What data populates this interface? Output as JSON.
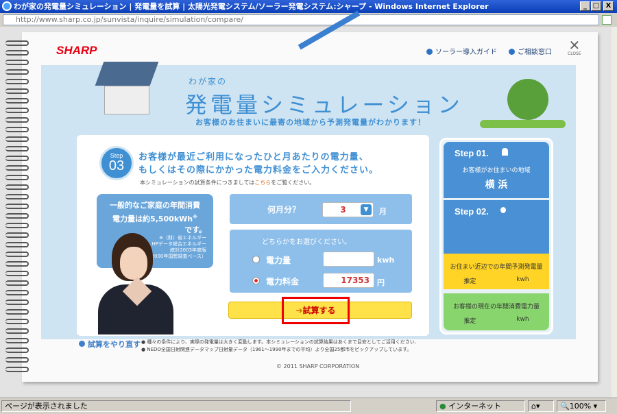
{
  "window": {
    "title": "わが家の発電量シミュレーション | 発電量を試算 | 太陽光発電システム/ソーラー発電システム:シャープ - Windows Internet Explorer",
    "minimize": "_",
    "maximize": "□",
    "close": "X"
  },
  "address": {
    "url": "http://www.sharp.co.jp/sunvista/inquire/simulation/compare/"
  },
  "header": {
    "logo": "SHARP",
    "link_guide": "ソーラー導入ガイド",
    "link_contact": "ご相談窓口",
    "close_label": "CLOSE"
  },
  "hero": {
    "small": "わが家の",
    "title": "発電量シミュレーション",
    "subtitle": "お客様のお住まいに最寄の地域から予測発電量がわかります！"
  },
  "step3": {
    "step_word": "Step",
    "step_num": "03",
    "question_line1": "お客様が最近ご利用になったひと月あたりの電力量、",
    "question_line2": "もしくはその際にかかった電力料金をご入力ください。",
    "note_pre": "本シミュレーションの試算条件につきましては",
    "note_link": "こちら",
    "note_post": "をご覧ください。"
  },
  "info": {
    "line1": "一般的なご家庭の年間消費",
    "line2": "電力量は約5,500kWh",
    "mark": "※",
    "line3": "です。",
    "src1": "※（財）省エネルギー",
    "src2": "HPデータ総合エネルギー",
    "src3": "統計2003年度版",
    "src4": "（2000年国勢調査ベース）"
  },
  "form": {
    "month_label": "何月分？",
    "month_value": "3",
    "month_unit": "月",
    "choose_label": "どちらかをお選びください。",
    "kwh_label": "電力量",
    "kwh_value": "",
    "kwh_unit": "kwh",
    "fee_label": "電力料金",
    "fee_value": "17353",
    "fee_unit": "円",
    "submit": "試算する"
  },
  "sidebar": {
    "step1": "Step 01.",
    "step1_desc": "お客様がお住まいの地域",
    "step1_value": "横 浜",
    "step2": "Step 02.",
    "yellow_title": "お住まい近辺での年間予測発電量",
    "yellow_est": "推定",
    "yellow_unit": "kwh",
    "green_title": "お客様の現在の年間消費電力量",
    "green_est": "推定",
    "green_unit": "kwh"
  },
  "footer": {
    "redo": "試算をやり直す",
    "note1": "● 種々の条件により、実際の発電量は大きく変動します。本シミュレーションの試算結果はあくまで目安としてご活用ください。",
    "note2": "● NEDO全国日射関連データマップ日射量データ（1961～1990年までの平均）より全国25都市をピックアップしています。",
    "copyright": "© 2011 SHARP CORPORATION"
  },
  "status": {
    "text": "ページが表示されました",
    "zone": "インターネット",
    "zoom": "100%"
  }
}
